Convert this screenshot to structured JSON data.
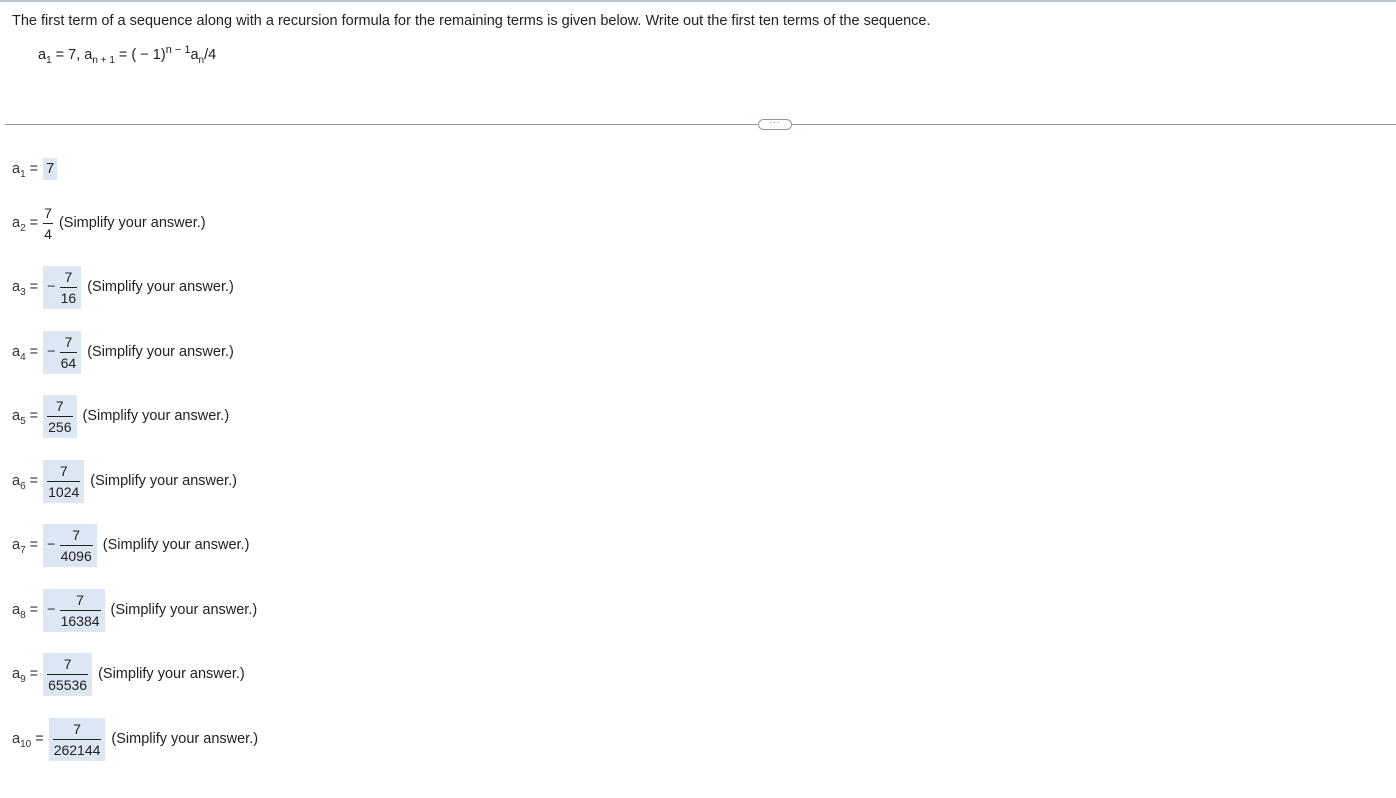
{
  "question": {
    "text": "The first term of a sequence along with a recursion formula for the remaining terms is given below. Write out the first ten terms of the sequence."
  },
  "formula": {
    "a1_label": "a",
    "a1_sub": "1",
    "a1_eq": " = 7, ",
    "an1_label": "a",
    "an1_sub": "n + 1",
    "eq_open": " = ( − 1)",
    "exp": "n − 1",
    "an_label": "a",
    "an_sub": "n",
    "tail": "/4"
  },
  "more_button": {
    "label": "···"
  },
  "answers": [
    {
      "label": "a",
      "sub": "1",
      "eq": " =",
      "sign": "",
      "value": "7",
      "hint": ""
    },
    {
      "label": "a",
      "sub": "2",
      "eq": " =",
      "sign": "",
      "num": "7",
      "den": "4",
      "hint": "(Simplify your answer.)"
    },
    {
      "label": "a",
      "sub": "3",
      "eq": " =",
      "sign": "−",
      "num": "7",
      "den": "16",
      "hint": "(Simplify your answer.)"
    },
    {
      "label": "a",
      "sub": "4",
      "eq": " =",
      "sign": "−",
      "num": "7",
      "den": "64",
      "hint": "(Simplify your answer.)"
    },
    {
      "label": "a",
      "sub": "5",
      "eq": " =",
      "sign": "",
      "num": "7",
      "den": "256",
      "hint": "(Simplify your answer.)"
    },
    {
      "label": "a",
      "sub": "6",
      "eq": " =",
      "sign": "",
      "num": "7",
      "den": "1024",
      "hint": "(Simplify your answer.)"
    },
    {
      "label": "a",
      "sub": "7",
      "eq": " =",
      "sign": "−",
      "num": "7",
      "den": "4096",
      "hint": "(Simplify your answer.)"
    },
    {
      "label": "a",
      "sub": "8",
      "eq": " =",
      "sign": "−",
      "num": "7",
      "den": "16384",
      "hint": "(Simplify your answer.)"
    },
    {
      "label": "a",
      "sub": "9",
      "eq": " =",
      "sign": "",
      "num": "7",
      "den": "65536",
      "hint": "(Simplify your answer.)"
    },
    {
      "label": "a",
      "sub": "10",
      "eq": " =",
      "sign": "",
      "num": "7",
      "den": "262144",
      "hint": "(Simplify your answer.)"
    }
  ]
}
